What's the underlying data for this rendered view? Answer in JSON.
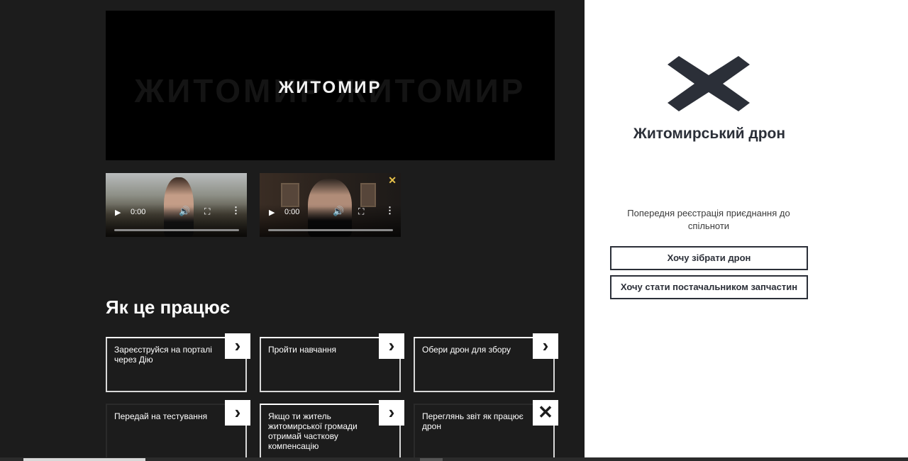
{
  "main_video": {
    "title_text": "ЖИТОМИР",
    "ghost_text": "ЖИТОМИР ЖИТОМИР"
  },
  "videos": [
    {
      "time": "0:00",
      "play_icon": "▶",
      "volume_icon": "🔊",
      "fullscreen_icon": "⛶",
      "more_icon": "⋮"
    },
    {
      "time": "0:00",
      "play_icon": "▶",
      "volume_icon": "🔊",
      "fullscreen_icon": "⛶",
      "more_icon": "⋮"
    }
  ],
  "how_it_works": {
    "title": "Як це працює",
    "steps": [
      {
        "text": "Зареєструйся на порталі через Дію",
        "icon": "›"
      },
      {
        "text": "Пройти навчання",
        "icon": "›"
      },
      {
        "text": "Обери дрон для збору",
        "icon": "›"
      },
      {
        "text": "Передай на тестування",
        "icon": "›"
      },
      {
        "text": "Якщо ти житель житомирської громади отримай часткову компенсацію",
        "icon": "›"
      },
      {
        "text": "Переглянь звіт як працює дрон",
        "icon": "✕"
      }
    ]
  },
  "sidebar": {
    "brand": "Житомирський дрон",
    "registration_note": "Попередня реєстрація приєднання до спільноти",
    "buttons": {
      "assemble": "Хочу зібрати дрон",
      "supplier": "Хочу стати постачальником запчастин"
    }
  },
  "colors": {
    "dark_bg": "#1c1c1c",
    "brand_dark": "#2b2f38",
    "white": "#ffffff"
  }
}
